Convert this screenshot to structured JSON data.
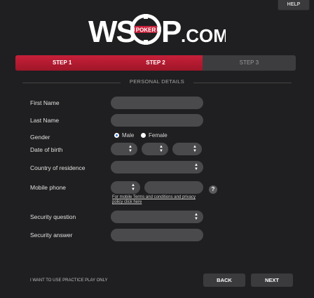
{
  "header": {
    "help_label": "HELP",
    "logo_text_left": "WS",
    "logo_text_right": "P",
    "logo_suffix": ".COM",
    "logo_chip_text": "POKER"
  },
  "steps": [
    {
      "label": "STEP 1",
      "state": "complete"
    },
    {
      "label": "STEP 2",
      "state": "active"
    },
    {
      "label": "STEP 3",
      "state": "inactive"
    }
  ],
  "section_title": "PERSONAL DETAILS",
  "form": {
    "first_name_label": "First Name",
    "last_name_label": "Last Name",
    "gender_label": "Gender",
    "gender_male": "Male",
    "gender_female": "Female",
    "gender_selected": "Male",
    "dob_label": "Date of birth",
    "country_label": "Country of residence",
    "mobile_label": "Mobile phone",
    "terms_text": "For mobile Terms and conditions and privacy policy click here",
    "help_mark": "?",
    "security_question_label": "Security question",
    "security_answer_label": "Security answer"
  },
  "footer": {
    "practice_label": "I WANT TO USE PRACTICE PLAY ONLY",
    "back_label": "BACK",
    "next_label": "NEXT"
  },
  "colors": {
    "accent_red": "#c8203a",
    "background": "#1f1f21",
    "field": "#4a4a4c"
  }
}
